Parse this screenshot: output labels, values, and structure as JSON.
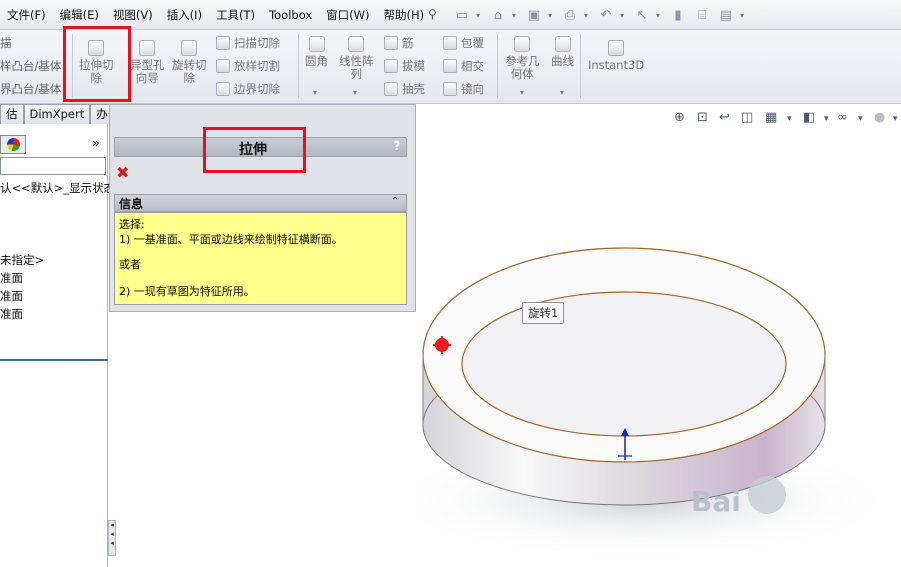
{
  "menu": {
    "items": [
      "文件(F)",
      "编辑(E)",
      "视图(V)",
      "插入(I)",
      "工具(T)",
      "Toolbox",
      "窗口(W)",
      "帮助(H)"
    ]
  },
  "ribbon": {
    "left_partial": [
      "描",
      "样凸台/基体",
      "界凸台/基体"
    ],
    "extrude_cut": "拉伸切\n除",
    "hole_wizard": "异型孔\n向导",
    "revolve_cut": "旋转切\n除",
    "sweep_cut": "扫描切除",
    "loft_cut": "放样切割",
    "boundary_cut": "边界切除",
    "fillet": "圆角",
    "linear_pattern": "线性阵\n列",
    "rib": "筋",
    "draft": "拔模",
    "shell": "抽壳",
    "wrap": "包覆",
    "intersect": "相交",
    "mirror": "镜向",
    "ref_geometry": "参考几\n何体",
    "curves": "曲线",
    "instant3d": "Instant3D"
  },
  "tabs": [
    "估",
    "DimXpert",
    "办公室产品"
  ],
  "tree": {
    "lines": [
      "认<<默认>_显示状态",
      "未指定>",
      "准面",
      "准面",
      "准面"
    ]
  },
  "property_manager": {
    "title": "拉伸",
    "help": "?",
    "info_header": "信息",
    "info_lines": [
      "选择:",
      "1) 一基准面、平面或边线来绘制特征横断面。",
      "或者",
      "2) 一现有草图为特征所用。"
    ]
  },
  "viewport": {
    "tooltip": "旋转1",
    "watermark": "Bai"
  },
  "colors": {
    "highlight_box": "#e0141e",
    "info_bg": "#ffff8c",
    "edge_color": "#a0682a"
  }
}
